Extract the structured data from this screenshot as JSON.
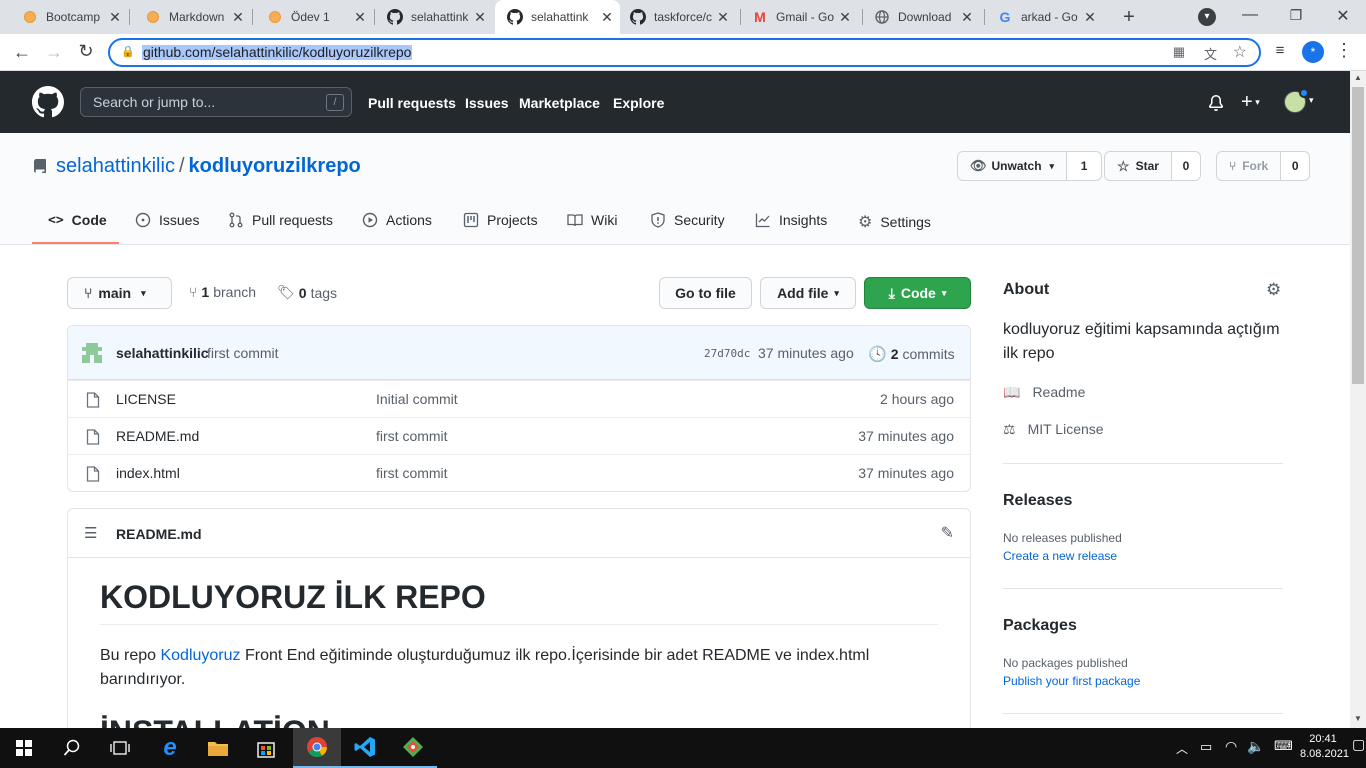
{
  "browser": {
    "tabs": [
      {
        "title": "Bootcamp",
        "icon": "bootcamp-favicon",
        "active": false
      },
      {
        "title": "Markdown",
        "icon": "bootcamp-favicon",
        "active": false
      },
      {
        "title": "Ödev 1",
        "icon": "bootcamp-favicon",
        "active": false
      },
      {
        "title": "selahattink",
        "icon": "github-favicon",
        "active": false
      },
      {
        "title": "selahattink",
        "icon": "github-favicon",
        "active": true
      },
      {
        "title": "taskforce/c",
        "icon": "github-favicon",
        "active": false
      },
      {
        "title": "Gmail - Go",
        "icon": "gmail-favicon",
        "active": false
      },
      {
        "title": "Download",
        "icon": "globe-favicon",
        "active": false
      },
      {
        "title": "arkad - Go",
        "icon": "google-favicon",
        "active": false
      }
    ],
    "url": "github.com/selahattinkilic/kodluyoruzilkrepo",
    "profile_initial": "*"
  },
  "github_header": {
    "search_placeholder": "Search or jump to...",
    "search_shortcut": "/",
    "nav": [
      "Pull requests",
      "Issues",
      "Marketplace",
      "Explore"
    ]
  },
  "repo": {
    "owner": "selahattinkilic",
    "separator": "/",
    "name": "kodluyoruzilkrepo",
    "watch_label": "Unwatch",
    "watch_count": "1",
    "star_label": "Star",
    "star_count": "0",
    "fork_label": "Fork",
    "fork_count": "0",
    "tabs": [
      "Code",
      "Issues",
      "Pull requests",
      "Actions",
      "Projects",
      "Wiki",
      "Security",
      "Insights",
      "Settings"
    ]
  },
  "code": {
    "branch": "main",
    "branch_count": "1",
    "branch_label": "branch",
    "tag_count": "0",
    "tag_label": "tags",
    "go_to_file": "Go to file",
    "add_file": "Add file",
    "code_button": "Code",
    "commit": {
      "author": "selahattinkilic",
      "message": "first commit",
      "sha": "27d70dc",
      "age": "37 minutes ago",
      "count": "2",
      "count_label": "commits"
    },
    "files": [
      {
        "name": "LICENSE",
        "message": "Initial commit",
        "age": "2 hours ago"
      },
      {
        "name": "README.md",
        "message": "first commit",
        "age": "37 minutes ago"
      },
      {
        "name": "index.html",
        "message": "first commit",
        "age": "37 minutes ago"
      }
    ]
  },
  "readme": {
    "filename": "README.md",
    "heading": "KODLUYORUZ İLK REPO",
    "para_before": "Bu repo ",
    "para_link": "Kodluyoruz",
    "para_after": " Front End eğitiminde oluşturduğumuz ilk repo.İçerisinde bir adet README ve index.html barındırıyor.",
    "heading2": "İNSTALLATİON"
  },
  "sidebar": {
    "about_title": "About",
    "description": "kodluyoruz eğitimi kapsamında açtığım ilk repo",
    "readme_label": "Readme",
    "license_label": "MIT License",
    "releases_title": "Releases",
    "no_releases": "No releases published",
    "create_release": "Create a new release",
    "packages_title": "Packages",
    "no_packages": "No packages published",
    "publish_package": "Publish your first package"
  },
  "taskbar": {
    "time": "20:41",
    "date": "8.08.2021"
  }
}
